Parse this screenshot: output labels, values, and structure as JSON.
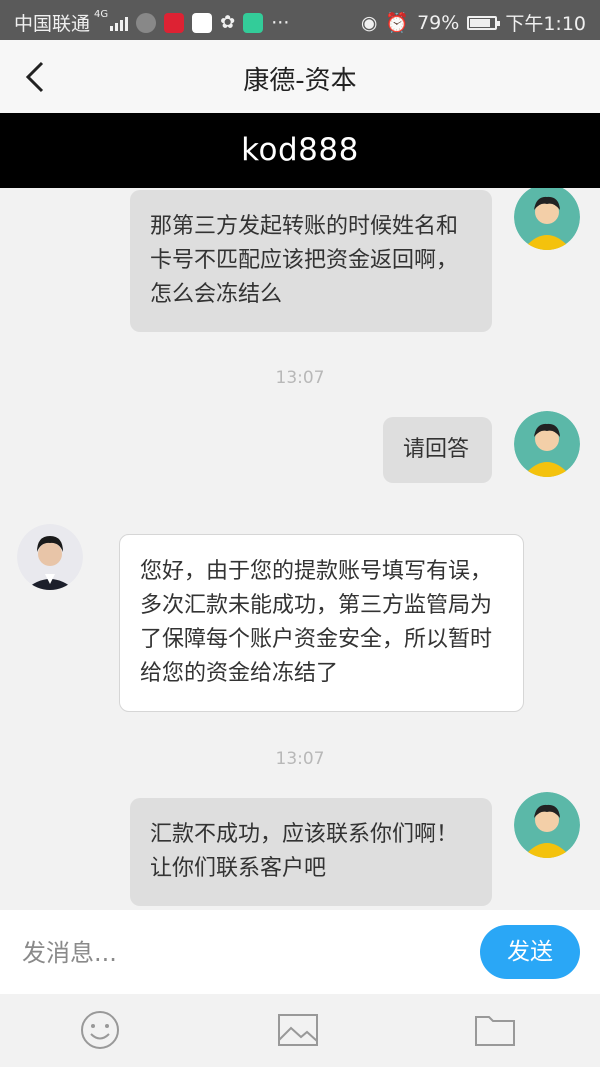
{
  "status_bar": {
    "carrier": "中国联通",
    "network": "4G",
    "more": "···",
    "battery": "79%",
    "time": "下午1:10",
    "icons": [
      "signal-icon",
      "app-icon",
      "app-icon",
      "app-icon",
      "wechat-icon",
      "app-icon",
      "eye-icon",
      "alarm-icon",
      "battery-icon"
    ]
  },
  "nav": {
    "title": "康德-资本",
    "back_icon": "chevron-left-icon"
  },
  "banner": {
    "text": "kod888"
  },
  "messages": [
    {
      "side": "out",
      "text": "那第三方发起转账的时候姓名和卡号不匹配应该把资金返回啊，怎么会冻结么"
    },
    {
      "type": "time",
      "text": "13:07"
    },
    {
      "side": "out",
      "text": "请回答"
    },
    {
      "side": "in",
      "text": "您好，由于您的提款账号填写有误，多次汇款未能成功，第三方监管局为了保障每个账户资金安全，所以暂时给您的资金给冻结了"
    },
    {
      "type": "time",
      "text": "13:07"
    },
    {
      "side": "out",
      "text": "汇款不成功，应该联系你们啊！让你们联系客户吧"
    }
  ],
  "input": {
    "placeholder": "发消息...",
    "value": ""
  },
  "send_label": "发送",
  "toolbar_icons": [
    "emoji-icon",
    "image-icon",
    "folder-icon"
  ],
  "colors": {
    "send": "#2aa7f6",
    "banner": "#000000",
    "user_avatar_bg": "#5bb8a8"
  }
}
